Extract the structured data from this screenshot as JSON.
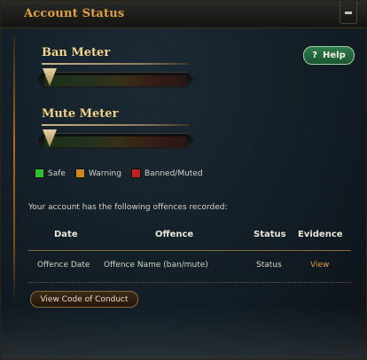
{
  "window": {
    "title": "Account Status"
  },
  "help_button": {
    "label": "Help",
    "icon": "?"
  },
  "meters": [
    {
      "label": "Ban Meter",
      "level_fraction": 0.0
    },
    {
      "label": "Mute Meter",
      "level_fraction": 0.0
    }
  ],
  "legend": [
    {
      "label": "Safe",
      "color": "#2fbf2f"
    },
    {
      "label": "Warning",
      "color": "#d08a1c"
    },
    {
      "label": "Banned/Muted",
      "color": "#c02020"
    }
  ],
  "intro_text": "Your account has the following offences recorded:",
  "table": {
    "headers": [
      "Date",
      "Offence",
      "Status",
      "Evidence"
    ],
    "rows": [
      [
        "Offence Date",
        "Offence Name (ban/mute)",
        "Status",
        "View"
      ]
    ]
  },
  "conduct_button": {
    "label": "View Code of Conduct"
  },
  "colors": {
    "accent": "#e2a13b",
    "help_green": "#2f7a4a"
  }
}
